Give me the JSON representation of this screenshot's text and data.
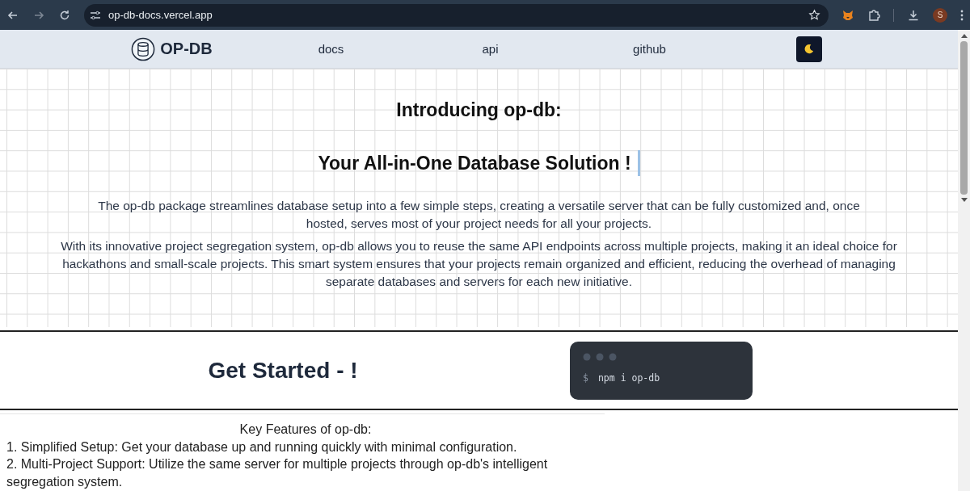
{
  "browser": {
    "url": "op-db-docs.vercel.app",
    "avatar": "S"
  },
  "nav": {
    "logo": "OP-DB",
    "links": [
      "docs",
      "api",
      "github"
    ]
  },
  "hero": {
    "title": "Introducing op-db:",
    "subtitle": "Your All-in-One Database Solution !",
    "paragraphs": [
      "The op-db package streamlines database setup into a few simple steps, creating a versatile server that can be fully customized and, once hosted, serves most of your project needs for all your projects.",
      "With its innovative project segregation system, op-db allows you to reuse the same API endpoints across multiple projects, making it an ideal choice for hackathons and small-scale projects. This smart system ensures that your projects remain organized and efficient, reducing the overhead of managing separate databases and servers for each new initiative."
    ]
  },
  "get_started": {
    "heading": "Get Started - !",
    "terminal": {
      "prompt": "$",
      "command": "npm i op-db"
    }
  },
  "features": {
    "heading": "Key Features of op-db:",
    "items": [
      "1. Simplified Setup: Get your database up and running quickly with minimal configuration.",
      "2. Multi-Project Support: Utilize the same server for multiple projects through op-db's intelligent segregation system."
    ]
  }
}
